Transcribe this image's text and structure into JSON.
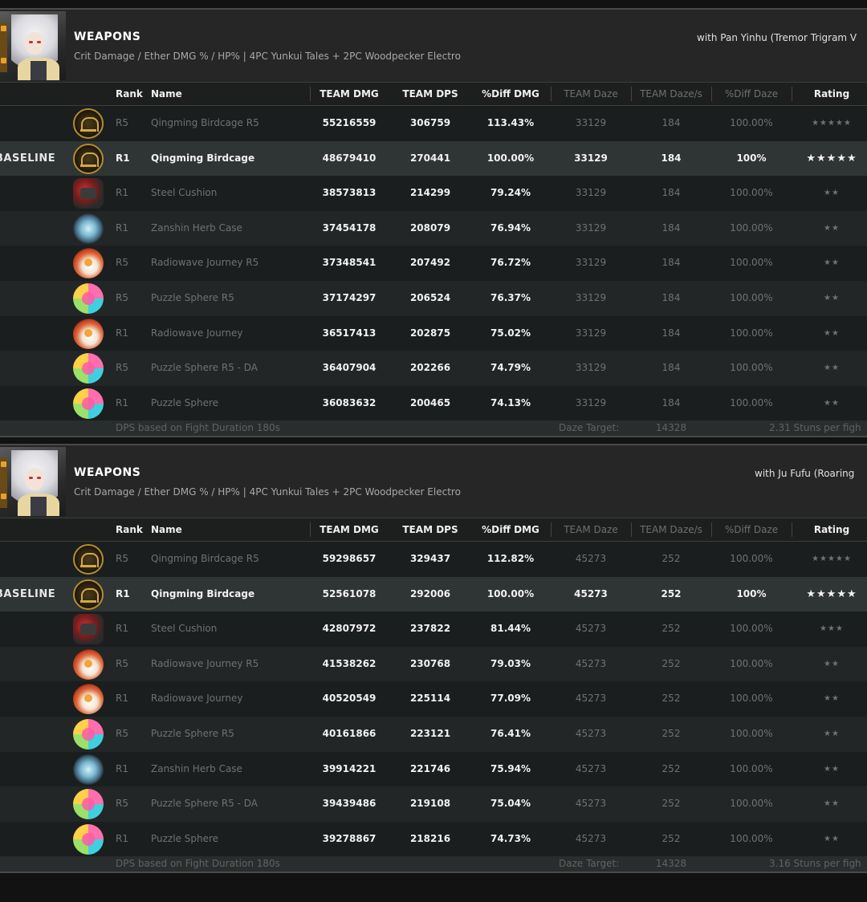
{
  "columns": {
    "rank": "Rank",
    "name": "Name",
    "team_dmg": "TEAM DMG",
    "team_dps": "TEAM DPS",
    "diff_dmg": "%Diff DMG",
    "team_daze": "TEAM Daze",
    "team_daze_s": "TEAM Daze/s",
    "diff_daze": "%Diff Daze",
    "rating": "Rating"
  },
  "panels": [
    {
      "title": "WEAPONS",
      "subtitle": "Crit Damage / Ether DMG % / HP%  |  4PC Yunkui Tales + 2PC Woodpecker Electro",
      "with_text": "with Pan Yinhu (Tremor Trigram V",
      "rows": [
        {
          "label": "",
          "icon": "birdcage-icon",
          "rank": "R5",
          "name": "Qingming Birdcage R5",
          "team_dmg": "55216559",
          "team_dps": "306759",
          "diff_dmg": "113.43%",
          "team_daze": "33129",
          "team_daze_s": "184",
          "diff_daze": "100.00%",
          "rating": "★★★★★"
        },
        {
          "label": "BASELINE",
          "icon": "birdcage-icon",
          "rank": "R1",
          "name": "Qingming Birdcage",
          "team_dmg": "48679410",
          "team_dps": "270441",
          "diff_dmg": "100.00%",
          "team_daze": "33129",
          "team_daze_s": "184",
          "diff_daze": "100%",
          "rating": "★★★★★"
        },
        {
          "label": "",
          "icon": "steel-cushion-icon",
          "rank": "R1",
          "name": "Steel Cushion",
          "team_dmg": "38573813",
          "team_dps": "214299",
          "diff_dmg": "79.24%",
          "team_daze": "33129",
          "team_daze_s": "184",
          "diff_daze": "100.00%",
          "rating": "★★"
        },
        {
          "label": "",
          "icon": "herb-case-icon",
          "rank": "R1",
          "name": "Zanshin Herb Case",
          "team_dmg": "37454178",
          "team_dps": "208079",
          "diff_dmg": "76.94%",
          "team_daze": "33129",
          "team_daze_s": "184",
          "diff_daze": "100.00%",
          "rating": "★★"
        },
        {
          "label": "",
          "icon": "radiowave-icon",
          "rank": "R5",
          "name": "Radiowave Journey R5",
          "team_dmg": "37348541",
          "team_dps": "207492",
          "diff_dmg": "76.72%",
          "team_daze": "33129",
          "team_daze_s": "184",
          "diff_daze": "100.00%",
          "rating": "★★"
        },
        {
          "label": "",
          "icon": "puzzle-sphere-icon",
          "rank": "R5",
          "name": "Puzzle Sphere R5",
          "team_dmg": "37174297",
          "team_dps": "206524",
          "diff_dmg": "76.37%",
          "team_daze": "33129",
          "team_daze_s": "184",
          "diff_daze": "100.00%",
          "rating": "★★"
        },
        {
          "label": "",
          "icon": "radiowave-icon",
          "rank": "R1",
          "name": "Radiowave Journey",
          "team_dmg": "36517413",
          "team_dps": "202875",
          "diff_dmg": "75.02%",
          "team_daze": "33129",
          "team_daze_s": "184",
          "diff_daze": "100.00%",
          "rating": "★★"
        },
        {
          "label": "",
          "icon": "puzzle-sphere-icon",
          "rank": "R5",
          "name": "Puzzle Sphere R5 - DA",
          "team_dmg": "36407904",
          "team_dps": "202266",
          "diff_dmg": "74.79%",
          "team_daze": "33129",
          "team_daze_s": "184",
          "diff_daze": "100.00%",
          "rating": "★★"
        },
        {
          "label": "",
          "icon": "puzzle-sphere-icon",
          "rank": "R1",
          "name": "Puzzle Sphere",
          "team_dmg": "36083632",
          "team_dps": "200465",
          "diff_dmg": "74.13%",
          "team_daze": "33129",
          "team_daze_s": "184",
          "diff_daze": "100.00%",
          "rating": "★★"
        }
      ],
      "footer": {
        "duration": "DPS based on Fight Duration 180s",
        "daze_label": "Daze Target:",
        "daze_value": "14328",
        "stuns": "2.31  Stuns per figh"
      }
    },
    {
      "title": "WEAPONS",
      "subtitle": "Crit Damage / Ether DMG % / HP%  |  4PC Yunkui Tales + 2PC Woodpecker Electro",
      "with_text": "with Ju Fufu (Roaring",
      "rows": [
        {
          "label": "",
          "icon": "birdcage-icon",
          "rank": "R5",
          "name": "Qingming Birdcage R5",
          "team_dmg": "59298657",
          "team_dps": "329437",
          "diff_dmg": "112.82%",
          "team_daze": "45273",
          "team_daze_s": "252",
          "diff_daze": "100.00%",
          "rating": "★★★★★"
        },
        {
          "label": "BASELINE",
          "icon": "birdcage-icon",
          "rank": "R1",
          "name": "Qingming Birdcage",
          "team_dmg": "52561078",
          "team_dps": "292006",
          "diff_dmg": "100.00%",
          "team_daze": "45273",
          "team_daze_s": "252",
          "diff_daze": "100%",
          "rating": "★★★★★"
        },
        {
          "label": "",
          "icon": "steel-cushion-icon",
          "rank": "R1",
          "name": "Steel Cushion",
          "team_dmg": "42807972",
          "team_dps": "237822",
          "diff_dmg": "81.44%",
          "team_daze": "45273",
          "team_daze_s": "252",
          "diff_daze": "100.00%",
          "rating": "★★★"
        },
        {
          "label": "",
          "icon": "radiowave-icon",
          "rank": "R5",
          "name": "Radiowave Journey R5",
          "team_dmg": "41538262",
          "team_dps": "230768",
          "diff_dmg": "79.03%",
          "team_daze": "45273",
          "team_daze_s": "252",
          "diff_daze": "100.00%",
          "rating": "★★"
        },
        {
          "label": "",
          "icon": "radiowave-icon",
          "rank": "R1",
          "name": "Radiowave Journey",
          "team_dmg": "40520549",
          "team_dps": "225114",
          "diff_dmg": "77.09%",
          "team_daze": "45273",
          "team_daze_s": "252",
          "diff_daze": "100.00%",
          "rating": "★★"
        },
        {
          "label": "",
          "icon": "puzzle-sphere-icon",
          "rank": "R5",
          "name": "Puzzle Sphere R5",
          "team_dmg": "40161866",
          "team_dps": "223121",
          "diff_dmg": "76.41%",
          "team_daze": "45273",
          "team_daze_s": "252",
          "diff_daze": "100.00%",
          "rating": "★★"
        },
        {
          "label": "",
          "icon": "herb-case-icon",
          "rank": "R1",
          "name": "Zanshin Herb Case",
          "team_dmg": "39914221",
          "team_dps": "221746",
          "diff_dmg": "75.94%",
          "team_daze": "45273",
          "team_daze_s": "252",
          "diff_daze": "100.00%",
          "rating": "★★"
        },
        {
          "label": "",
          "icon": "puzzle-sphere-icon",
          "rank": "R5",
          "name": "Puzzle Sphere R5 - DA",
          "team_dmg": "39439486",
          "team_dps": "219108",
          "diff_dmg": "75.04%",
          "team_daze": "45273",
          "team_daze_s": "252",
          "diff_daze": "100.00%",
          "rating": "★★"
        },
        {
          "label": "",
          "icon": "puzzle-sphere-icon",
          "rank": "R1",
          "name": "Puzzle Sphere",
          "team_dmg": "39278867",
          "team_dps": "218216",
          "diff_dmg": "74.73%",
          "team_daze": "45273",
          "team_daze_s": "252",
          "diff_daze": "100.00%",
          "rating": "★★"
        }
      ],
      "footer": {
        "duration": "DPS based on Fight Duration 180s",
        "daze_label": "Daze Target:",
        "daze_value": "14328",
        "stuns": "3.16  Stuns per figh"
      }
    }
  ]
}
